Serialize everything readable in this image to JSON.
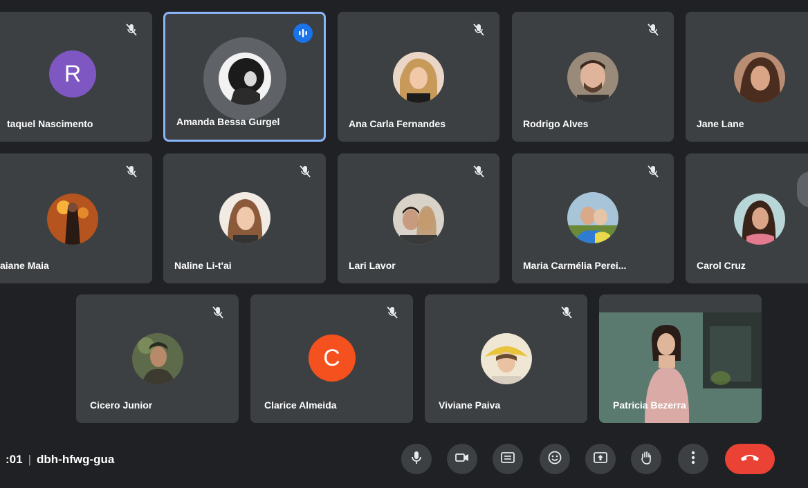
{
  "participants": [
    {
      "name": "Raquel Nascimento",
      "shown_name": "taquel Nascimento",
      "avatar_letter": "R",
      "avatar_color": "#7e57c2",
      "muted": true
    },
    {
      "name": "Amanda Bessa Gurgel",
      "shown_name": "Amanda Bessa Gurgel",
      "speaking": true,
      "muted": false
    },
    {
      "name": "Ana Carla Fernandes",
      "shown_name": "Ana Carla Fernandes",
      "muted": true
    },
    {
      "name": "Rodrigo Alves",
      "shown_name": "Rodrigo Alves",
      "muted": true
    },
    {
      "name": "Jane Lane",
      "shown_name": "Jane Lane",
      "muted": false
    },
    {
      "name": "Taiane Maia",
      "shown_name": "aiane Maia",
      "muted": true
    },
    {
      "name": "Naline Li-t'ai",
      "shown_name": "Naline Li-t'ai",
      "muted": true
    },
    {
      "name": "Lari Lavor",
      "shown_name": "Lari Lavor",
      "muted": true
    },
    {
      "name": "Maria Carmélia Perei...",
      "shown_name": "Maria Carmélia Perei...",
      "muted": true
    },
    {
      "name": "Carol Cruz",
      "shown_name": "Carol Cruz",
      "muted": false
    },
    {
      "name": "Cicero Junior",
      "shown_name": "Cicero Junior",
      "muted": true
    },
    {
      "name": "Clarice Almeida",
      "shown_name": "Clarice Almeida",
      "avatar_letter": "C",
      "avatar_color": "#f4511e",
      "muted": true
    },
    {
      "name": "Viviane Paiva",
      "shown_name": "Viviane Paiva",
      "muted": true
    },
    {
      "name": "Patricia Bezerra",
      "shown_name": "Patricia Bezerra",
      "video_on": true,
      "muted": false
    }
  ],
  "bottom_bar": {
    "time": ":01",
    "separator": "|",
    "meeting_code": "dbh-hfwg-gua",
    "controls": [
      "mic-icon",
      "camera-icon",
      "captions-icon",
      "emoji-icon",
      "present-icon",
      "raise-hand-icon",
      "more-options-icon",
      "end-call-icon"
    ]
  },
  "colors": {
    "background": "#202124",
    "tile": "#3c4043",
    "active_border": "#8ab4f8",
    "speaking_badge": "#1a73e8",
    "end_call": "#ea4335"
  }
}
